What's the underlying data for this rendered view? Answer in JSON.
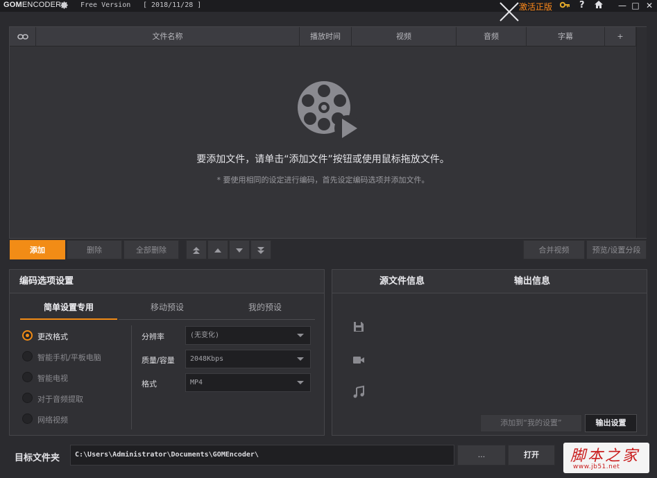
{
  "titlebar": {
    "logo_bold": "GOM",
    "logo_light": "ENCODER",
    "free_version": "Free Version",
    "build_date": "[ 2018/11/28 ]",
    "activate_label": "激活正版",
    "icons": [
      "gear-icon",
      "key-icon",
      "help-icon",
      "home-icon",
      "minimize-icon",
      "maximize-icon",
      "close-icon"
    ],
    "help_glyph": "?",
    "min_glyph": "—",
    "max_glyph": "□",
    "close_glyph": "✕"
  },
  "filelist": {
    "columns": [
      "文件名称",
      "播放时间",
      "视频",
      "音频",
      "字幕",
      "+"
    ],
    "hint_main": "要添加文件，请单击“添加文件”按钮或使用鼠标拖放文件。",
    "hint_sub": "* 要使用相同的设定进行编码，首先设定编码选项并添加文件。"
  },
  "actions": {
    "add": "添加",
    "delete": "删除",
    "delete_all": "全部删除",
    "move_first": "⏫",
    "move_up": "▲",
    "move_down": "▼",
    "move_last": "⏬",
    "merge": "合并视频",
    "preview": "预览/设置分段"
  },
  "encode": {
    "title": "编码选项设置",
    "tabs": [
      "简单设置专用",
      "移动预设",
      "我的预设"
    ],
    "options": [
      "更改格式",
      "智能手机/平板电脑",
      "智能电视",
      "对于音频提取",
      "网络视频"
    ],
    "selected_option": 0,
    "fields": [
      {
        "label": "分辨率",
        "value": "(无变化)"
      },
      {
        "label": "质量/容量",
        "value": "2048Kbps"
      },
      {
        "label": "格式",
        "value": "MP4"
      }
    ]
  },
  "info": {
    "source_title": "源文件信息",
    "output_title": "输出信息",
    "add_preset": "添加到“我的设置”",
    "output_settings": "输出设置"
  },
  "target": {
    "label": "目标文件夹",
    "path": "C:\\Users\\Administrator\\Documents\\GOMEncoder\\",
    "browse": "...",
    "open": "打开"
  },
  "watermark": {
    "text": "脚本之家",
    "url": "www.jb51.net"
  },
  "colors": {
    "accent": "#f28c16",
    "activate": "#ff8a1a",
    "background": "#2b2b2f"
  }
}
